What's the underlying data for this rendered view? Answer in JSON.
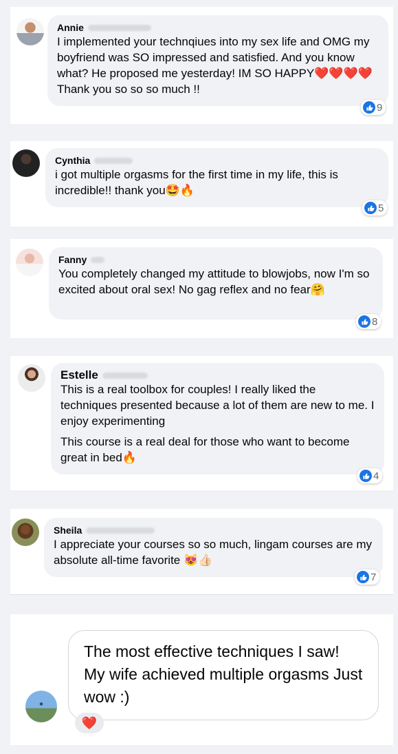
{
  "comments": [
    {
      "first_name": "Annie",
      "text": "I implemented your technqiues into my sex life and OMG my boyfriend was SO impressed and satisfied. And you know what? He proposed me yesterday! IM SO HAPPY❤️❤️❤️❤️ Thank you so so so much !!",
      "likes": "9"
    },
    {
      "first_name": "Cynthia",
      "text": "i got multiple orgasms for the first time in my life, this is incredible!! thank you🤩🔥",
      "likes": "5"
    },
    {
      "first_name": "Fanny",
      "text": "You completely changed my attitude to blowjobs, now I'm so excited about oral sex! No gag reflex and no fear🤗",
      "likes": "8"
    },
    {
      "first_name": "Estelle",
      "text": "This is a real toolbox for couples! I really liked the techniques presented because a lot of them are new to me. I enjoy experimenting",
      "text2": "This course is a real deal for those who want to become great in bed🔥",
      "likes": "4"
    },
    {
      "first_name": "Sheila",
      "text": "I appreciate your courses so so much, lingam courses are my absolute all-time favorite 😻👍🏻",
      "likes": "7"
    }
  ],
  "testimonial": {
    "text": "The most effective techniques I saw! My wife achieved multiple orgasms Just wow :)",
    "reaction": "❤️"
  },
  "colors": {
    "like_blue": "#1b74e4",
    "bubble_grey": "#f0f2f5"
  },
  "icons": {
    "like": "thumbs-up-icon",
    "reaction": "heart-icon"
  }
}
